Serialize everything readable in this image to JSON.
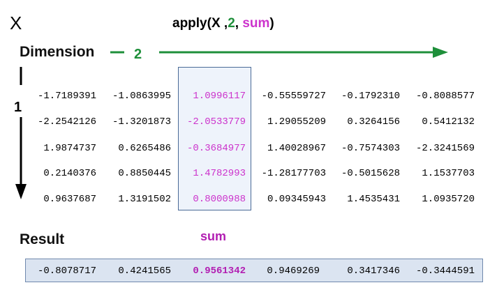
{
  "title": {
    "x": "X",
    "apply_prefix": "apply(X ,",
    "apply_margin": "2",
    "apply_sep": ", ",
    "apply_fun": "sum",
    "apply_suffix": ")"
  },
  "dimension_label": "Dimension",
  "dimension_row": "2",
  "dimension_col": "1",
  "result_label": "Result",
  "sum_label": "sum",
  "colors": {
    "green": "#1e8f3a",
    "magenta": "#cc33cc",
    "result_magenta": "#b21eb2",
    "highlight_border": "#4a6a96",
    "result_bg": "#dbe4f1"
  },
  "highlight_column": 2,
  "matrix": [
    [
      "-1.7189391",
      "-1.0863995",
      " 1.0996117",
      "-0.55559727",
      "-0.1792310",
      "-0.8088577"
    ],
    [
      "-2.2542126",
      "-1.3201873",
      "-2.0533779",
      " 1.29055209",
      " 0.3264156",
      " 0.5412132"
    ],
    [
      " 1.9874737",
      " 0.6265486",
      "-0.3684977",
      " 1.40028967",
      "-0.7574303",
      "-2.3241569"
    ],
    [
      " 0.2140376",
      " 0.8850445",
      " 1.4782993",
      "-1.28177703",
      "-0.5015628",
      " 1.1537703"
    ],
    [
      " 0.9637687",
      " 1.3191502",
      " 0.8000988",
      " 0.09345943",
      " 1.4535431",
      " 1.0935720"
    ]
  ],
  "result": [
    "-0.8078717",
    " 0.4241565",
    " 0.9561342",
    " 0.9469269",
    " 0.3417346",
    "-0.3444591"
  ]
}
